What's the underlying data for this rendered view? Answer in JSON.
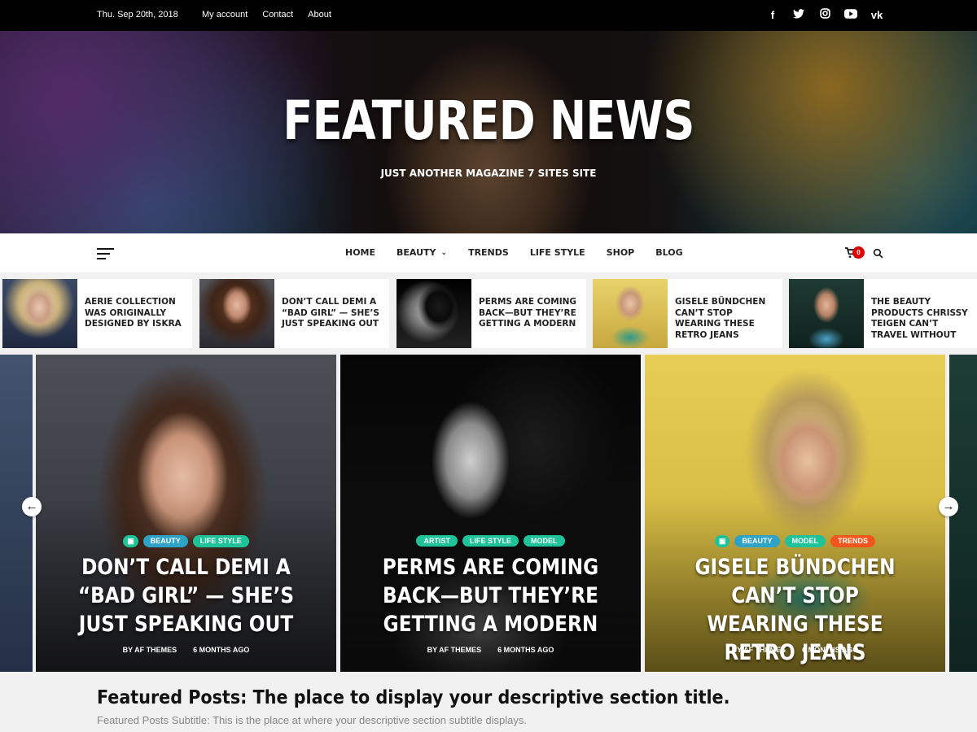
{
  "topbar": {
    "date": "Thu. Sep 20th, 2018",
    "links": [
      "My account",
      "Contact",
      "About"
    ],
    "social": [
      {
        "icon": "facebook-icon",
        "glyph": "f"
      },
      {
        "icon": "twitter-icon",
        "glyph": "t"
      },
      {
        "icon": "instagram-icon",
        "glyph": "◎"
      },
      {
        "icon": "youtube-icon",
        "glyph": "▶"
      },
      {
        "icon": "vk-icon",
        "glyph": "vk"
      }
    ]
  },
  "hero": {
    "title": "FEATURED NEWS",
    "tagline": "JUST ANOTHER MAGAZINE 7 SITES SITE"
  },
  "nav": {
    "items": [
      "HOME",
      "BEAUTY",
      "TRENDS",
      "LIFE STYLE",
      "SHOP",
      "BLOG"
    ],
    "cart_count": "0"
  },
  "trending": [
    {
      "title": "AERIE COLLECTION WAS ORIGINALLY DESIGNED BY ISKRA"
    },
    {
      "title": "DON’T CALL DEMI A “BAD GIRL” — SHE’S JUST SPEAKING OUT"
    },
    {
      "title": "PERMS ARE COMING BACK—BUT THEY’RE GETTING A MODERN"
    },
    {
      "title": "GISELE BÜNDCHEN CAN’T STOP WEARING THESE RETRO JEANS"
    },
    {
      "title": "THE BEAUTY PRODUCTS CHRISSY TEIGEN CAN’T TRAVEL WITHOUT"
    }
  ],
  "slides": [
    {
      "categories": [
        "BEAUTY",
        "LIFE STYLE"
      ],
      "headline": "DON’T CALL DEMI A “BAD GIRL” — SHE’S JUST SPEAKING OUT",
      "author": "BY AF THEMES",
      "time": "6 MONTHS AGO"
    },
    {
      "categories": [
        "ARTIST",
        "LIFE STYLE",
        "MODEL"
      ],
      "headline": "PERMS ARE COMING BACK—BUT THEY’RE GETTING A MODERN",
      "author": "BY AF THEMES",
      "time": "6 MONTHS AGO"
    },
    {
      "categories": [
        "BEAUTY",
        "MODEL",
        "TRENDS"
      ],
      "headline": "GISELE BÜNDCHEN CAN’T STOP WEARING THESE RETRO JEANS",
      "author": "BY AF THEMES",
      "time": "6 MONTHS AGO"
    }
  ],
  "section": {
    "title": "Featured Posts: The place to display your descriptive section title.",
    "subtitle": "Featured Posts Subtitle: This is the place at where your descriptive section subtitle displays."
  },
  "colors": {
    "cat_blue": "#2ea3c7",
    "cat_green": "#1fc39a",
    "cat_orange": "#f2561d",
    "cart_badge": "#dd0000"
  }
}
